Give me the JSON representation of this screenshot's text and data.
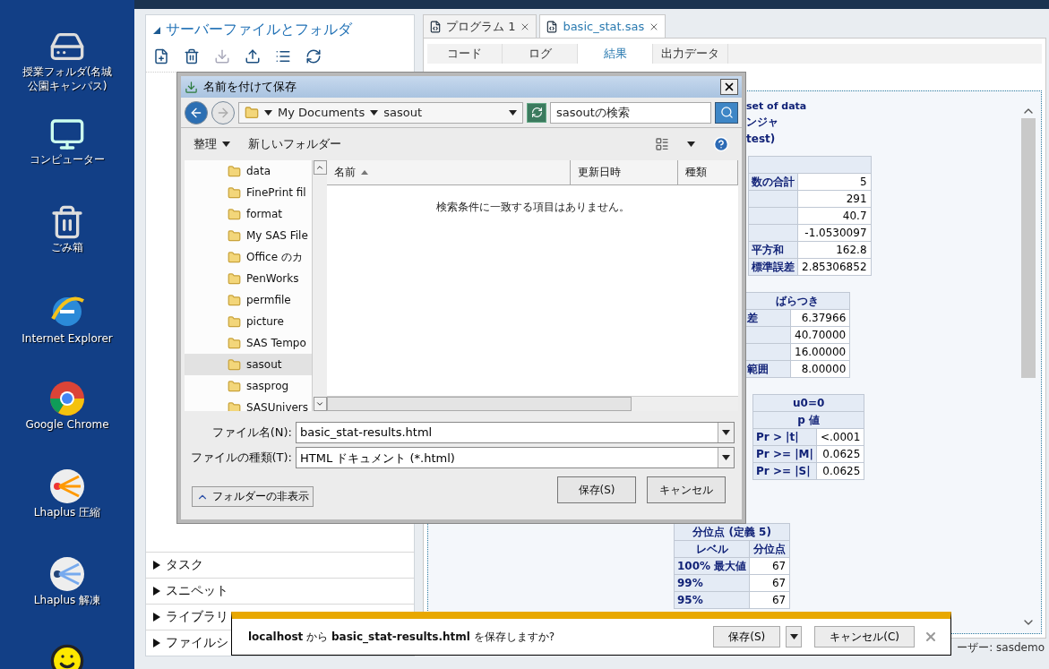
{
  "desktop_icons": [
    {
      "label": "授業フォルダ(名城公園キャンパス)",
      "kind": "network"
    },
    {
      "label": "コンピューター",
      "kind": "computer"
    },
    {
      "label": "ごみ箱",
      "kind": "trash"
    },
    {
      "label": "Internet Explorer",
      "kind": "ie"
    },
    {
      "label": "Google Chrome",
      "kind": "chrome"
    },
    {
      "label": "Lhaplus 圧縮",
      "kind": "compress"
    },
    {
      "label": "Lhaplus 解凍",
      "kind": "extract"
    },
    {
      "kind": "smiley"
    }
  ],
  "studio": {
    "files_panel": {
      "title": "サーバーファイルとフォルダ",
      "expanded": true
    },
    "sections": [
      {
        "label": "タスク",
        "expanded": false
      },
      {
        "label": "スニペット",
        "expanded": false
      },
      {
        "label": "ライブラリ",
        "expanded": false
      },
      {
        "label": "ファイルシ",
        "expanded": false
      }
    ],
    "tabs": [
      {
        "label": "プログラム 1",
        "selected": false
      },
      {
        "label": "basic_stat.sas",
        "selected": true
      }
    ],
    "subtabs": [
      {
        "label": "コード",
        "selected": false
      },
      {
        "label": "ログ",
        "selected": false
      },
      {
        "label": "結果",
        "selected": true
      },
      {
        "label": "出力データ",
        "selected": false
      }
    ],
    "results": {
      "title": "set of data",
      "lines": [
        "ンジャ",
        "test)"
      ],
      "tables": [
        {
          "rows": [
            [
              "数の合計",
              "5"
            ],
            [
              "",
              "291"
            ],
            [
              "",
              "40.7"
            ],
            [
              "",
              "-1.0530097"
            ],
            [
              "平方和",
              "162.8"
            ],
            [
              "標準誤差",
              "2.85306852"
            ]
          ]
        },
        {
          "caption": "ばらつき",
          "rows": [
            [
              "差",
              "6.37966"
            ],
            [
              "",
              "40.70000"
            ],
            [
              "",
              "16.00000"
            ],
            [
              "範囲",
              "8.00000"
            ]
          ]
        },
        {
          "caption": "u0=0",
          "header": [
            "p 値"
          ],
          "rows": [
            [
              "Pr > |t|",
              "<.0001"
            ],
            [
              "Pr >= |M|",
              "0.0625"
            ],
            [
              "Pr >= |S|",
              "0.0625"
            ]
          ]
        },
        {
          "caption": "分位点 (定義 5)",
          "header": [
            "レベル",
            "分位点"
          ],
          "rows": [
            [
              "100% 最大値",
              "67"
            ],
            [
              "99%",
              "67"
            ],
            [
              "95%",
              "67"
            ]
          ]
        }
      ]
    },
    "status_bar": "ーザー: sasdemo"
  },
  "dialog": {
    "title": "名前を付けて保存",
    "breadcrumb": [
      "My Documents",
      "sasout"
    ],
    "search": {
      "placeholder": "sasoutの検索"
    },
    "toolbar": [
      "整理",
      "新しいフォルダー"
    ],
    "folders": [
      {
        "label": "data",
        "selected": false
      },
      {
        "label": "FinePrint fil",
        "selected": false
      },
      {
        "label": "format",
        "selected": false
      },
      {
        "label": "My SAS File",
        "selected": false
      },
      {
        "label": "Office のカ",
        "selected": false
      },
      {
        "label": "PenWorks",
        "selected": false
      },
      {
        "label": "permfile",
        "selected": false
      },
      {
        "label": "picture",
        "selected": false
      },
      {
        "label": "SAS Tempo",
        "selected": false
      },
      {
        "label": "sasout",
        "selected": true
      },
      {
        "label": "sasprog",
        "selected": false
      },
      {
        "label": "SASUnivers",
        "selected": false
      }
    ],
    "columns": [
      {
        "label": "名前",
        "sorted": true
      },
      {
        "label": "更新日時",
        "sorted": false
      },
      {
        "label": "種類",
        "sorted": false
      }
    ],
    "empty_message": "検索条件に一致する項目はありません。",
    "file_name": {
      "label": "ファイル名(N):",
      "value": "basic_stat-results.html"
    },
    "file_type": {
      "label": "ファイルの種類(T):",
      "value": "HTML ドキュメント (*.html)"
    },
    "toggle": "フォルダーの非表示",
    "buttons": [
      "保存(S)",
      "キャンセル"
    ]
  },
  "download_bar": {
    "message": "**localhost** から **basic_stat-results.html** を保存しますか?",
    "buttons": [
      "保存(S)",
      "キャンセル(C)"
    ]
  }
}
